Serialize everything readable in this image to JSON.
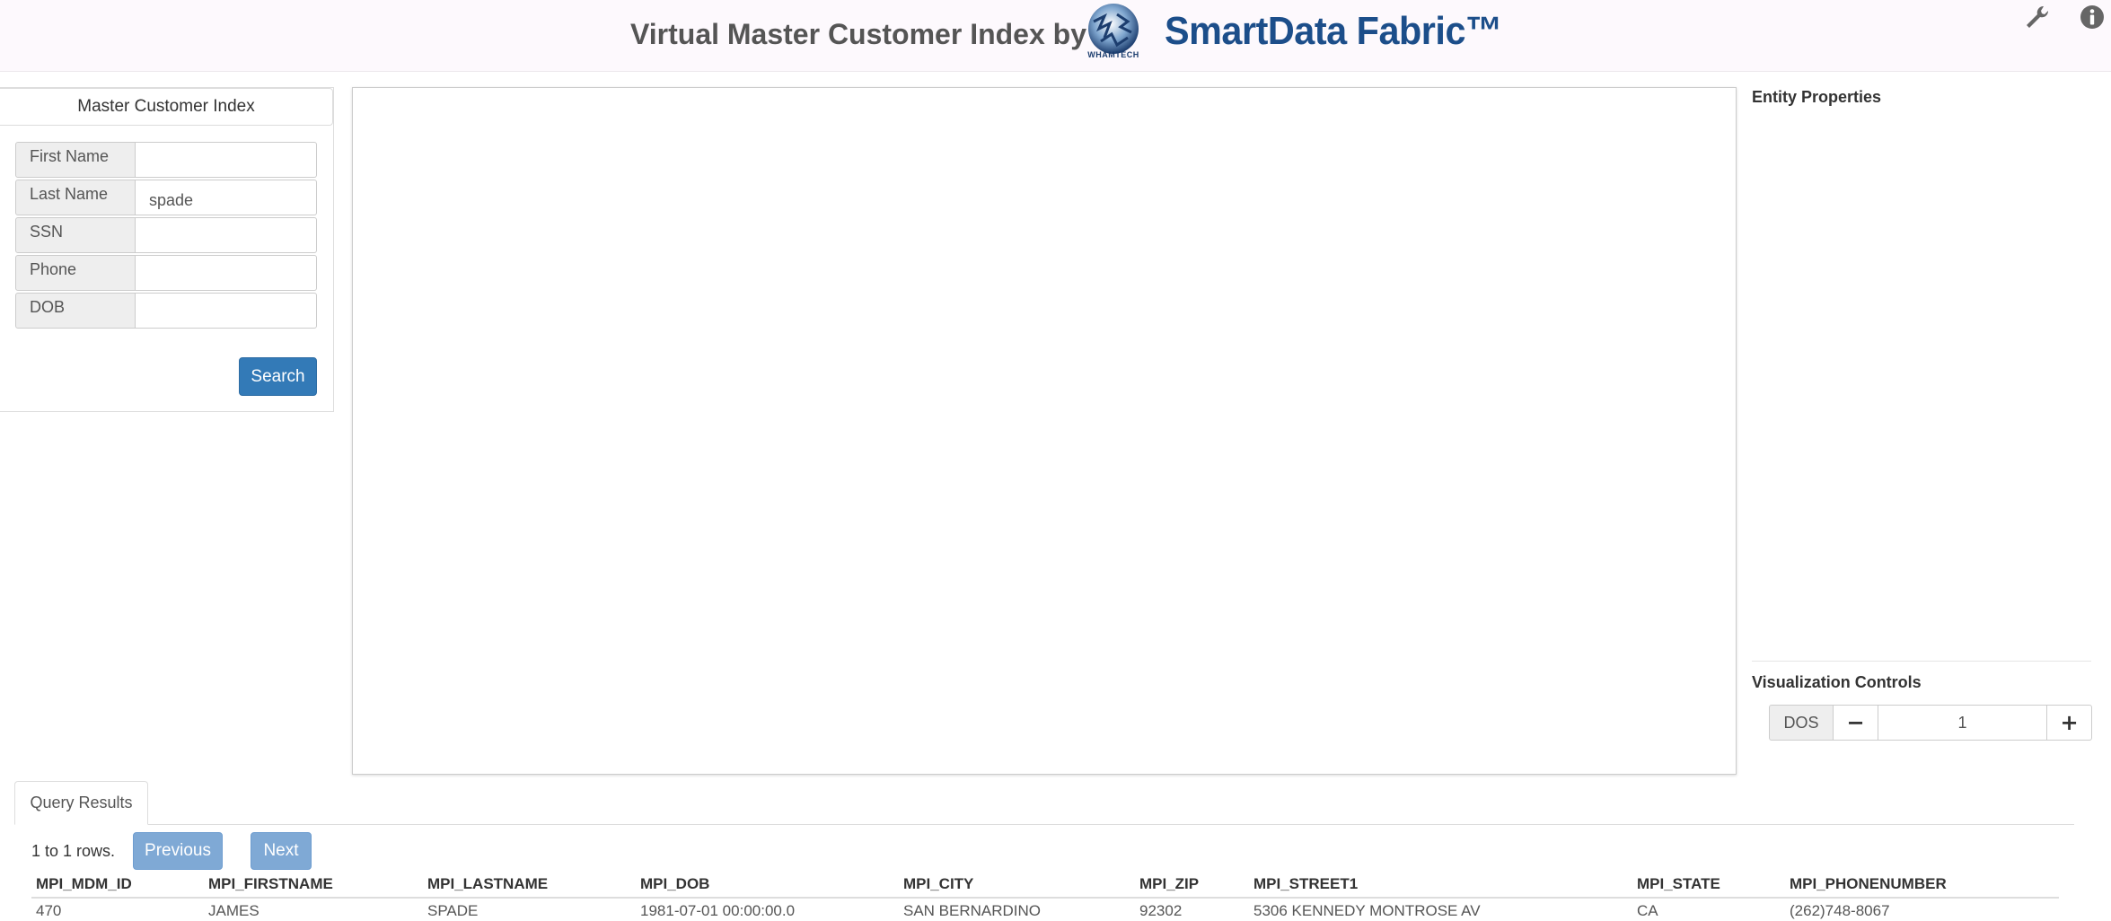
{
  "header": {
    "title": "Virtual Master Customer Index by",
    "logo_caption": "WHAMTECH",
    "brand": "SmartData Fabric™",
    "settings_icon": "wrench-icon",
    "info_icon": "info-circle-icon",
    "accent_color": "#1c4e8a"
  },
  "search_panel": {
    "heading": "Master Customer Index",
    "fields": [
      {
        "label": "First Name",
        "value": ""
      },
      {
        "label": "Last Name",
        "value": "spade"
      },
      {
        "label": "SSN",
        "value": ""
      },
      {
        "label": "Phone",
        "value": ""
      },
      {
        "label": "DOB",
        "value": ""
      }
    ],
    "search_label": "Search",
    "button_color": "#337ab7"
  },
  "entity_properties": {
    "title": "Entity Properties"
  },
  "visualization_controls": {
    "title": "Visualization Controls",
    "dos_label": "DOS",
    "decrement_icon": "minus-icon",
    "increment_icon": "plus-icon",
    "decrement_symbol": "−",
    "increment_symbol": "+",
    "dos_value": "1"
  },
  "results": {
    "tab_label": "Query Results",
    "row_count": "1 to 1 rows.",
    "previous_label": "Previous",
    "next_label": "Next",
    "columns": [
      "MPI_MDM_ID",
      "MPI_FIRSTNAME",
      "MPI_LASTNAME",
      "MPI_DOB",
      "MPI_CITY",
      "MPI_ZIP",
      "MPI_STREET1",
      "MPI_STATE",
      "MPI_PHONENUMBER"
    ],
    "rows": [
      [
        "470",
        "JAMES",
        "SPADE",
        "1981-07-01 00:00:00.0",
        "SAN BERNARDINO",
        "92302",
        "5306 KENNEDY MONTROSE AV",
        "CA",
        "(262)748-8067"
      ]
    ]
  }
}
